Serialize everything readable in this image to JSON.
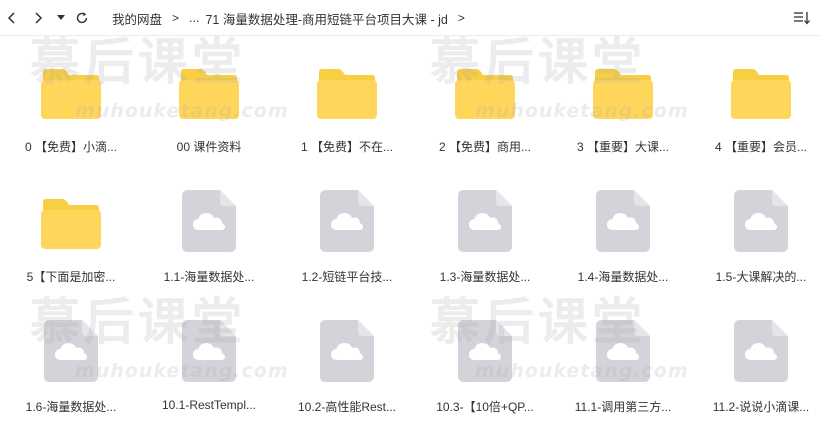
{
  "toolbar": {
    "breadcrumbs": [
      "我的网盘",
      "...",
      "71 海量数据处理-商用短链平台项目大课 - jd"
    ],
    "separator": ">"
  },
  "watermark": {
    "text": "慕后课堂",
    "url": "muhouketang.com"
  },
  "files": [
    {
      "type": "folder",
      "name": "0 【免费】小滴..."
    },
    {
      "type": "folder",
      "name": "00 课件资料"
    },
    {
      "type": "folder",
      "name": "1 【免费】不在..."
    },
    {
      "type": "folder",
      "name": "2 【免费】商用..."
    },
    {
      "type": "folder",
      "name": "3 【重要】大课..."
    },
    {
      "type": "folder",
      "name": "4 【重要】会员..."
    },
    {
      "type": "folder",
      "name": "5【下面是加密..."
    },
    {
      "type": "file",
      "name": "1.1-海量数据处..."
    },
    {
      "type": "file",
      "name": "1.2-短链平台技..."
    },
    {
      "type": "file",
      "name": "1.3-海量数据处..."
    },
    {
      "type": "file",
      "name": "1.4-海量数据处..."
    },
    {
      "type": "file",
      "name": "1.5-大课解决的..."
    },
    {
      "type": "file",
      "name": "1.6-海量数据处..."
    },
    {
      "type": "file",
      "name": "10.1-RestTempl..."
    },
    {
      "type": "file",
      "name": "10.2-高性能Rest..."
    },
    {
      "type": "file",
      "name": "10.3-【10倍+QP..."
    },
    {
      "type": "file",
      "name": "11.1-调用第三方..."
    },
    {
      "type": "file",
      "name": "11.2-说说小滴课..."
    }
  ],
  "colors": {
    "folder_back": "#f8cf43",
    "folder_front": "#ffd65c",
    "file_body": "#d2d4da",
    "file_fold": "#e3e5e9",
    "cloud": "#ffffff"
  }
}
